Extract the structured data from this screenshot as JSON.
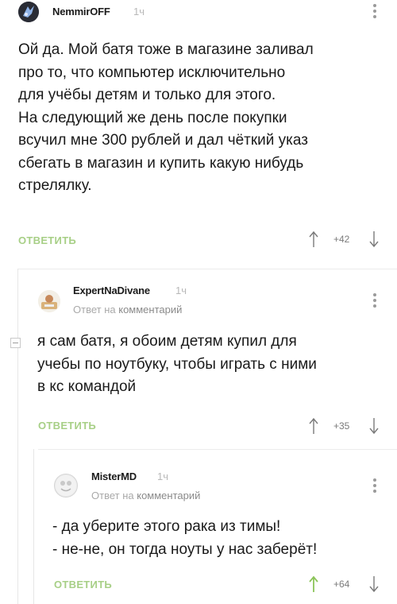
{
  "comments": [
    {
      "author": "NemmirOFF",
      "time": "1ч",
      "text": "Ой да. Мой батя тоже в магазине заливал\nпро то, что компьютер исключительно\nдля учёбы детям и только для этого.\nНа следующий же день после покупки\nвсучил мне 300 рублей и дал чёткий указ\nсбегать в магазин и купить какую нибудь\nстрелялку.",
      "reply_label": "ОТВЕТИТЬ",
      "score": "+42"
    },
    {
      "author": "ExpertNaDivane",
      "time": "1ч",
      "reply_to_prefix": "Ответ на",
      "reply_to_target": "комментарий",
      "text": "я сам батя, я обоим детям купил для\nучебы по ноутбуку, чтобы играть с ними\nв кс командой",
      "reply_label": "ОТВЕТИТЬ",
      "score": "+35"
    },
    {
      "author": "MisterMD",
      "time": "1ч",
      "reply_to_prefix": "Ответ на",
      "reply_to_target": "комментарий",
      "text": "- да уберите этого рака из тимы!\n- не-не, он тогда ноуты у нас заберёт!",
      "reply_label": "ОТВЕТИТЬ",
      "score": "+64"
    }
  ],
  "colors": {
    "reply_green": "#a7cf86",
    "upvoted_green": "#8cc45a",
    "muted": "#a9a9a9"
  },
  "icons": {
    "more": "vertical-dots-icon",
    "up": "arrow-up-icon",
    "down": "arrow-down-icon"
  }
}
